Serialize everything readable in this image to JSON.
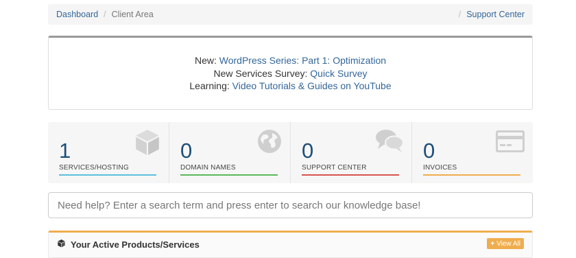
{
  "breadcrumb": {
    "home": "Dashboard",
    "separator": "/",
    "current": "Client Area",
    "right_separator": "/",
    "right_link": "Support Center"
  },
  "announcements": [
    {
      "label": "New:",
      "link": "WordPress Series: Part 1: Optimization"
    },
    {
      "label": "New Services Survey:",
      "link": "Quick Survey"
    },
    {
      "label": "Learning:",
      "link": "Video Tutorials & Guides on YouTube"
    }
  ],
  "tiles": [
    {
      "count": "1",
      "title": "SERVICES/HOSTING",
      "color": "#5bc0de",
      "icon": "cube-icon"
    },
    {
      "count": "0",
      "title": "DOMAIN NAMES",
      "color": "#5cb85c",
      "icon": "globe-icon"
    },
    {
      "count": "0",
      "title": "SUPPORT CENTER",
      "color": "#d9534f",
      "icon": "comments-icon"
    },
    {
      "count": "0",
      "title": "INVOICES",
      "color": "#f0ad4e",
      "icon": "credit-card-icon"
    }
  ],
  "search": {
    "placeholder": "Need help? Enter a search term and press enter to search our knowledge base!"
  },
  "products_panel": {
    "title": "Your Active Products/Services",
    "icon": "cube-icon",
    "view_all_label": "View All",
    "accent": "#f0ad4e"
  }
}
